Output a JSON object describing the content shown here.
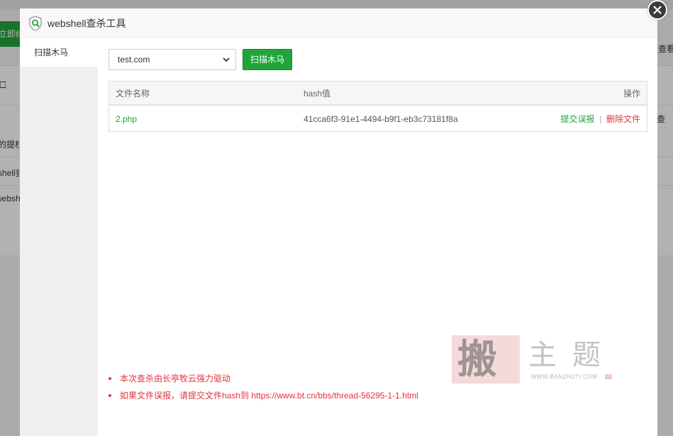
{
  "background": {
    "green_button_label": "立即续费",
    "right_link": "查看授权",
    "menu_fragments": [
      "口",
      "查",
      "的提权",
      "shell查",
      "webshell"
    ]
  },
  "dialog": {
    "title": "webshell查杀工具",
    "sidebar": {
      "items": [
        {
          "label": "扫描木马",
          "active": true
        }
      ]
    },
    "site_select": {
      "value": "test.com",
      "options_visible": [
        "test.com"
      ]
    },
    "scan_button": "扫描木马",
    "table": {
      "columns": [
        "文件名称",
        "hash值",
        "操作"
      ],
      "rows": [
        {
          "file": "2.php",
          "hash": "41cca6f3-91e1-4494-b9f1-eb3c73181f8a",
          "actions": {
            "report": "提交误报",
            "separator": "|",
            "delete": "删除文件"
          }
        }
      ]
    },
    "notes": [
      "本次查杀由长亭牧云强力驱动",
      "如果文件误报，请提交文件hash到 https://www.bt.cn/bbs/thread-56295-1-1.html"
    ]
  },
  "watermark": {
    "seal_char": "搬",
    "chars": "主题",
    "url": "WWW.BANZHUTI.COM"
  },
  "colors": {
    "accent_green": "#20a53a",
    "danger_red": "#e0343a",
    "overlay": "#000000"
  },
  "icons": {
    "title_logo": "shield-search-icon",
    "close": "close-icon",
    "select_arrow": "chevron-down-icon"
  }
}
